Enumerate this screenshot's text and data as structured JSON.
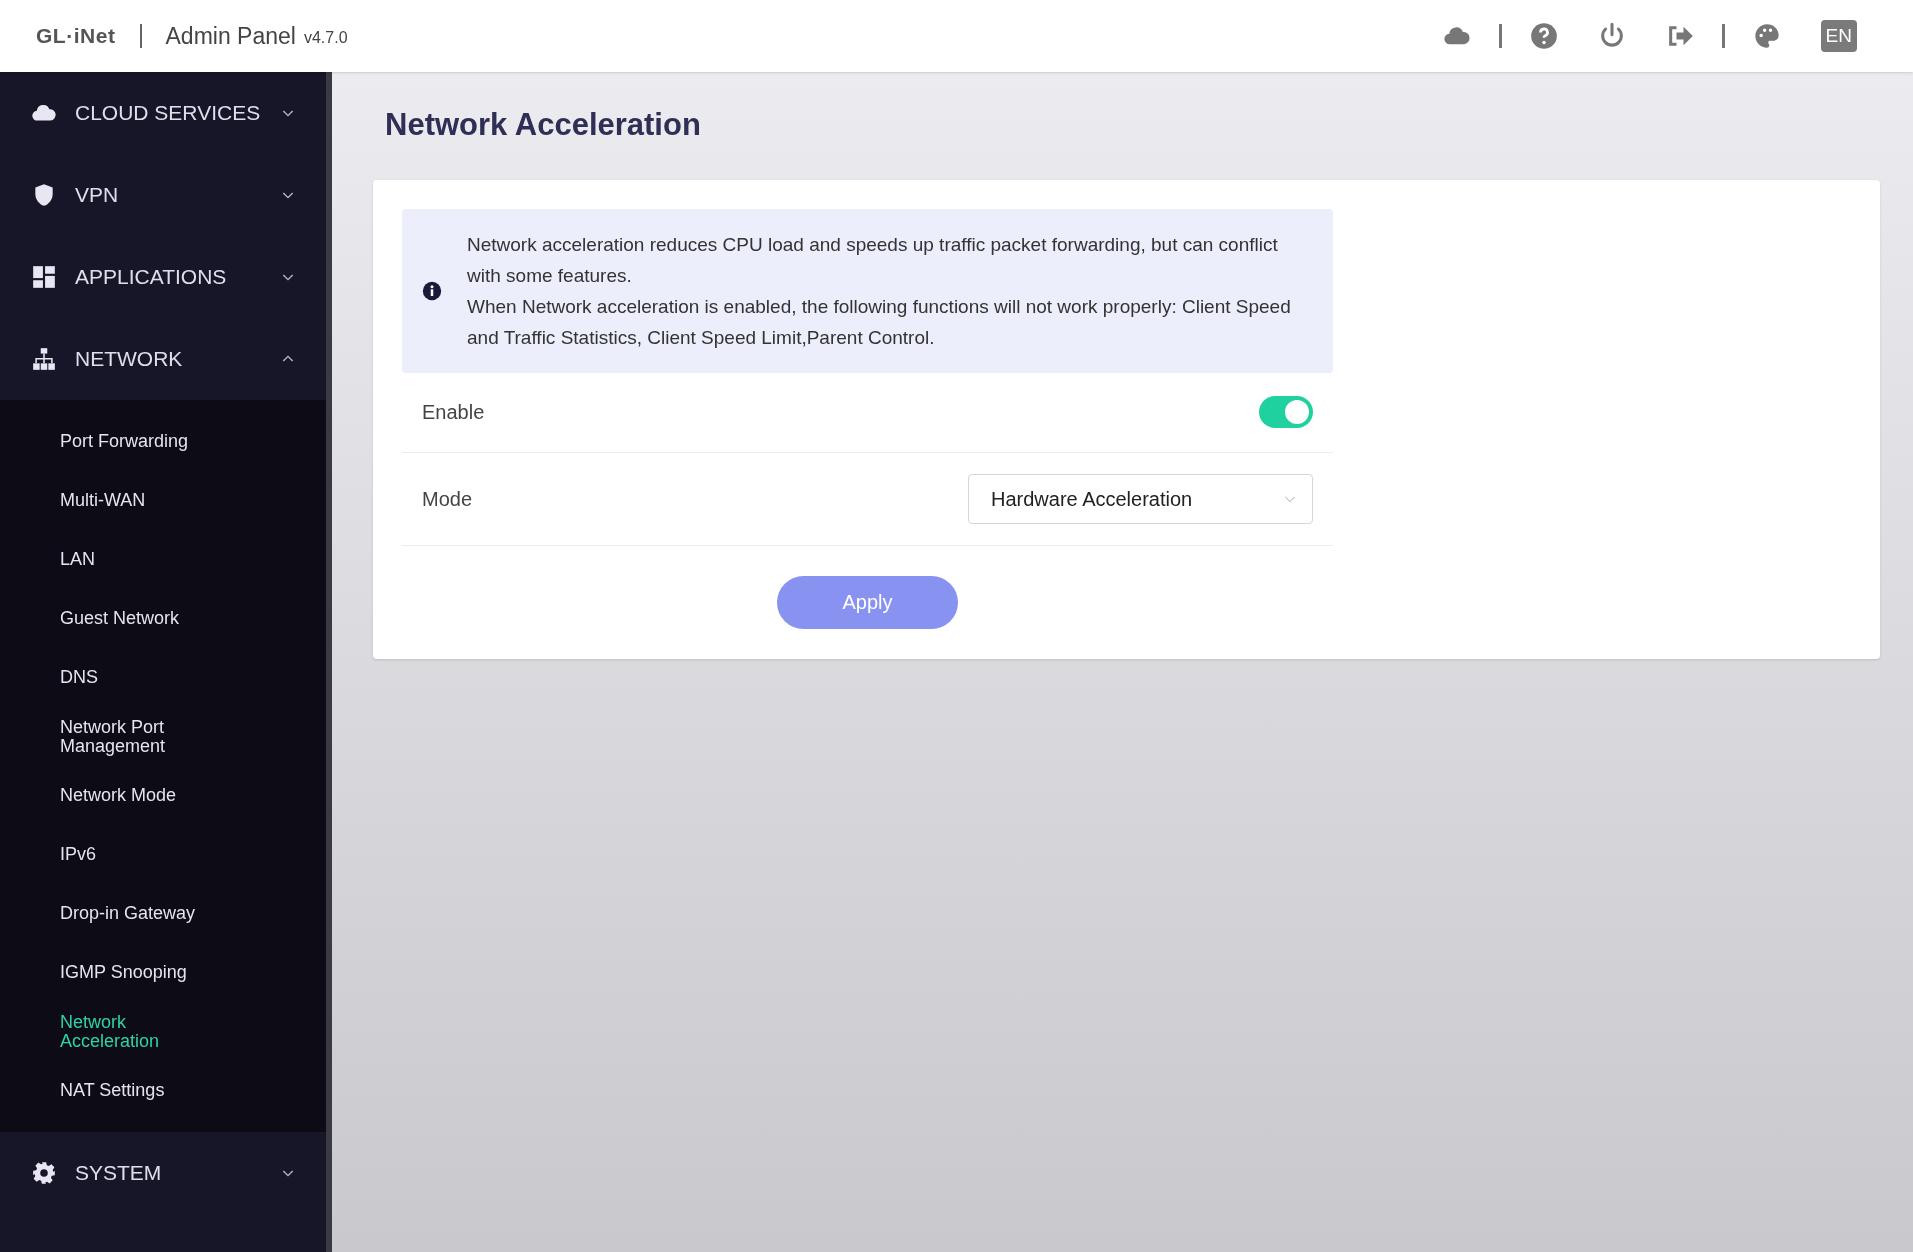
{
  "header": {
    "logo": "GL·iNet",
    "title": "Admin Panel",
    "version": "v4.7.0",
    "language": "EN"
  },
  "sidebar": {
    "sections": [
      {
        "label": "CLOUD SERVICES",
        "expanded": false
      },
      {
        "label": "VPN",
        "expanded": false
      },
      {
        "label": "APPLICATIONS",
        "expanded": false
      },
      {
        "label": "NETWORK",
        "expanded": true,
        "children": [
          {
            "label": "Port Forwarding",
            "selected": false
          },
          {
            "label": "Multi-WAN",
            "selected": false
          },
          {
            "label": "LAN",
            "selected": false
          },
          {
            "label": "Guest Network",
            "selected": false
          },
          {
            "label": "DNS",
            "selected": false
          },
          {
            "label": "Network Port Management",
            "selected": false
          },
          {
            "label": "Network Mode",
            "selected": false
          },
          {
            "label": "IPv6",
            "selected": false
          },
          {
            "label": "Drop-in Gateway",
            "selected": false
          },
          {
            "label": "IGMP Snooping",
            "selected": false
          },
          {
            "label": "Network Acceleration",
            "selected": true
          },
          {
            "label": "NAT Settings",
            "selected": false
          }
        ]
      },
      {
        "label": "SYSTEM",
        "expanded": false
      }
    ]
  },
  "page_title": "Network Acceleration",
  "notice": [
    "Network acceleration reduces CPU load and speeds up traffic packet forwarding, but can conflict with some features.",
    "When Network acceleration is enabled, the following functions will not work properly: Client Speed and Traffic Statistics, Client Speed Limit,Parent Control."
  ],
  "settings": [
    {
      "kind": "toggle",
      "label": "Enable",
      "on": true
    },
    {
      "kind": "select",
      "label": "Mode",
      "value": "Hardware Acceleration"
    }
  ],
  "apply_button": "Apply"
}
